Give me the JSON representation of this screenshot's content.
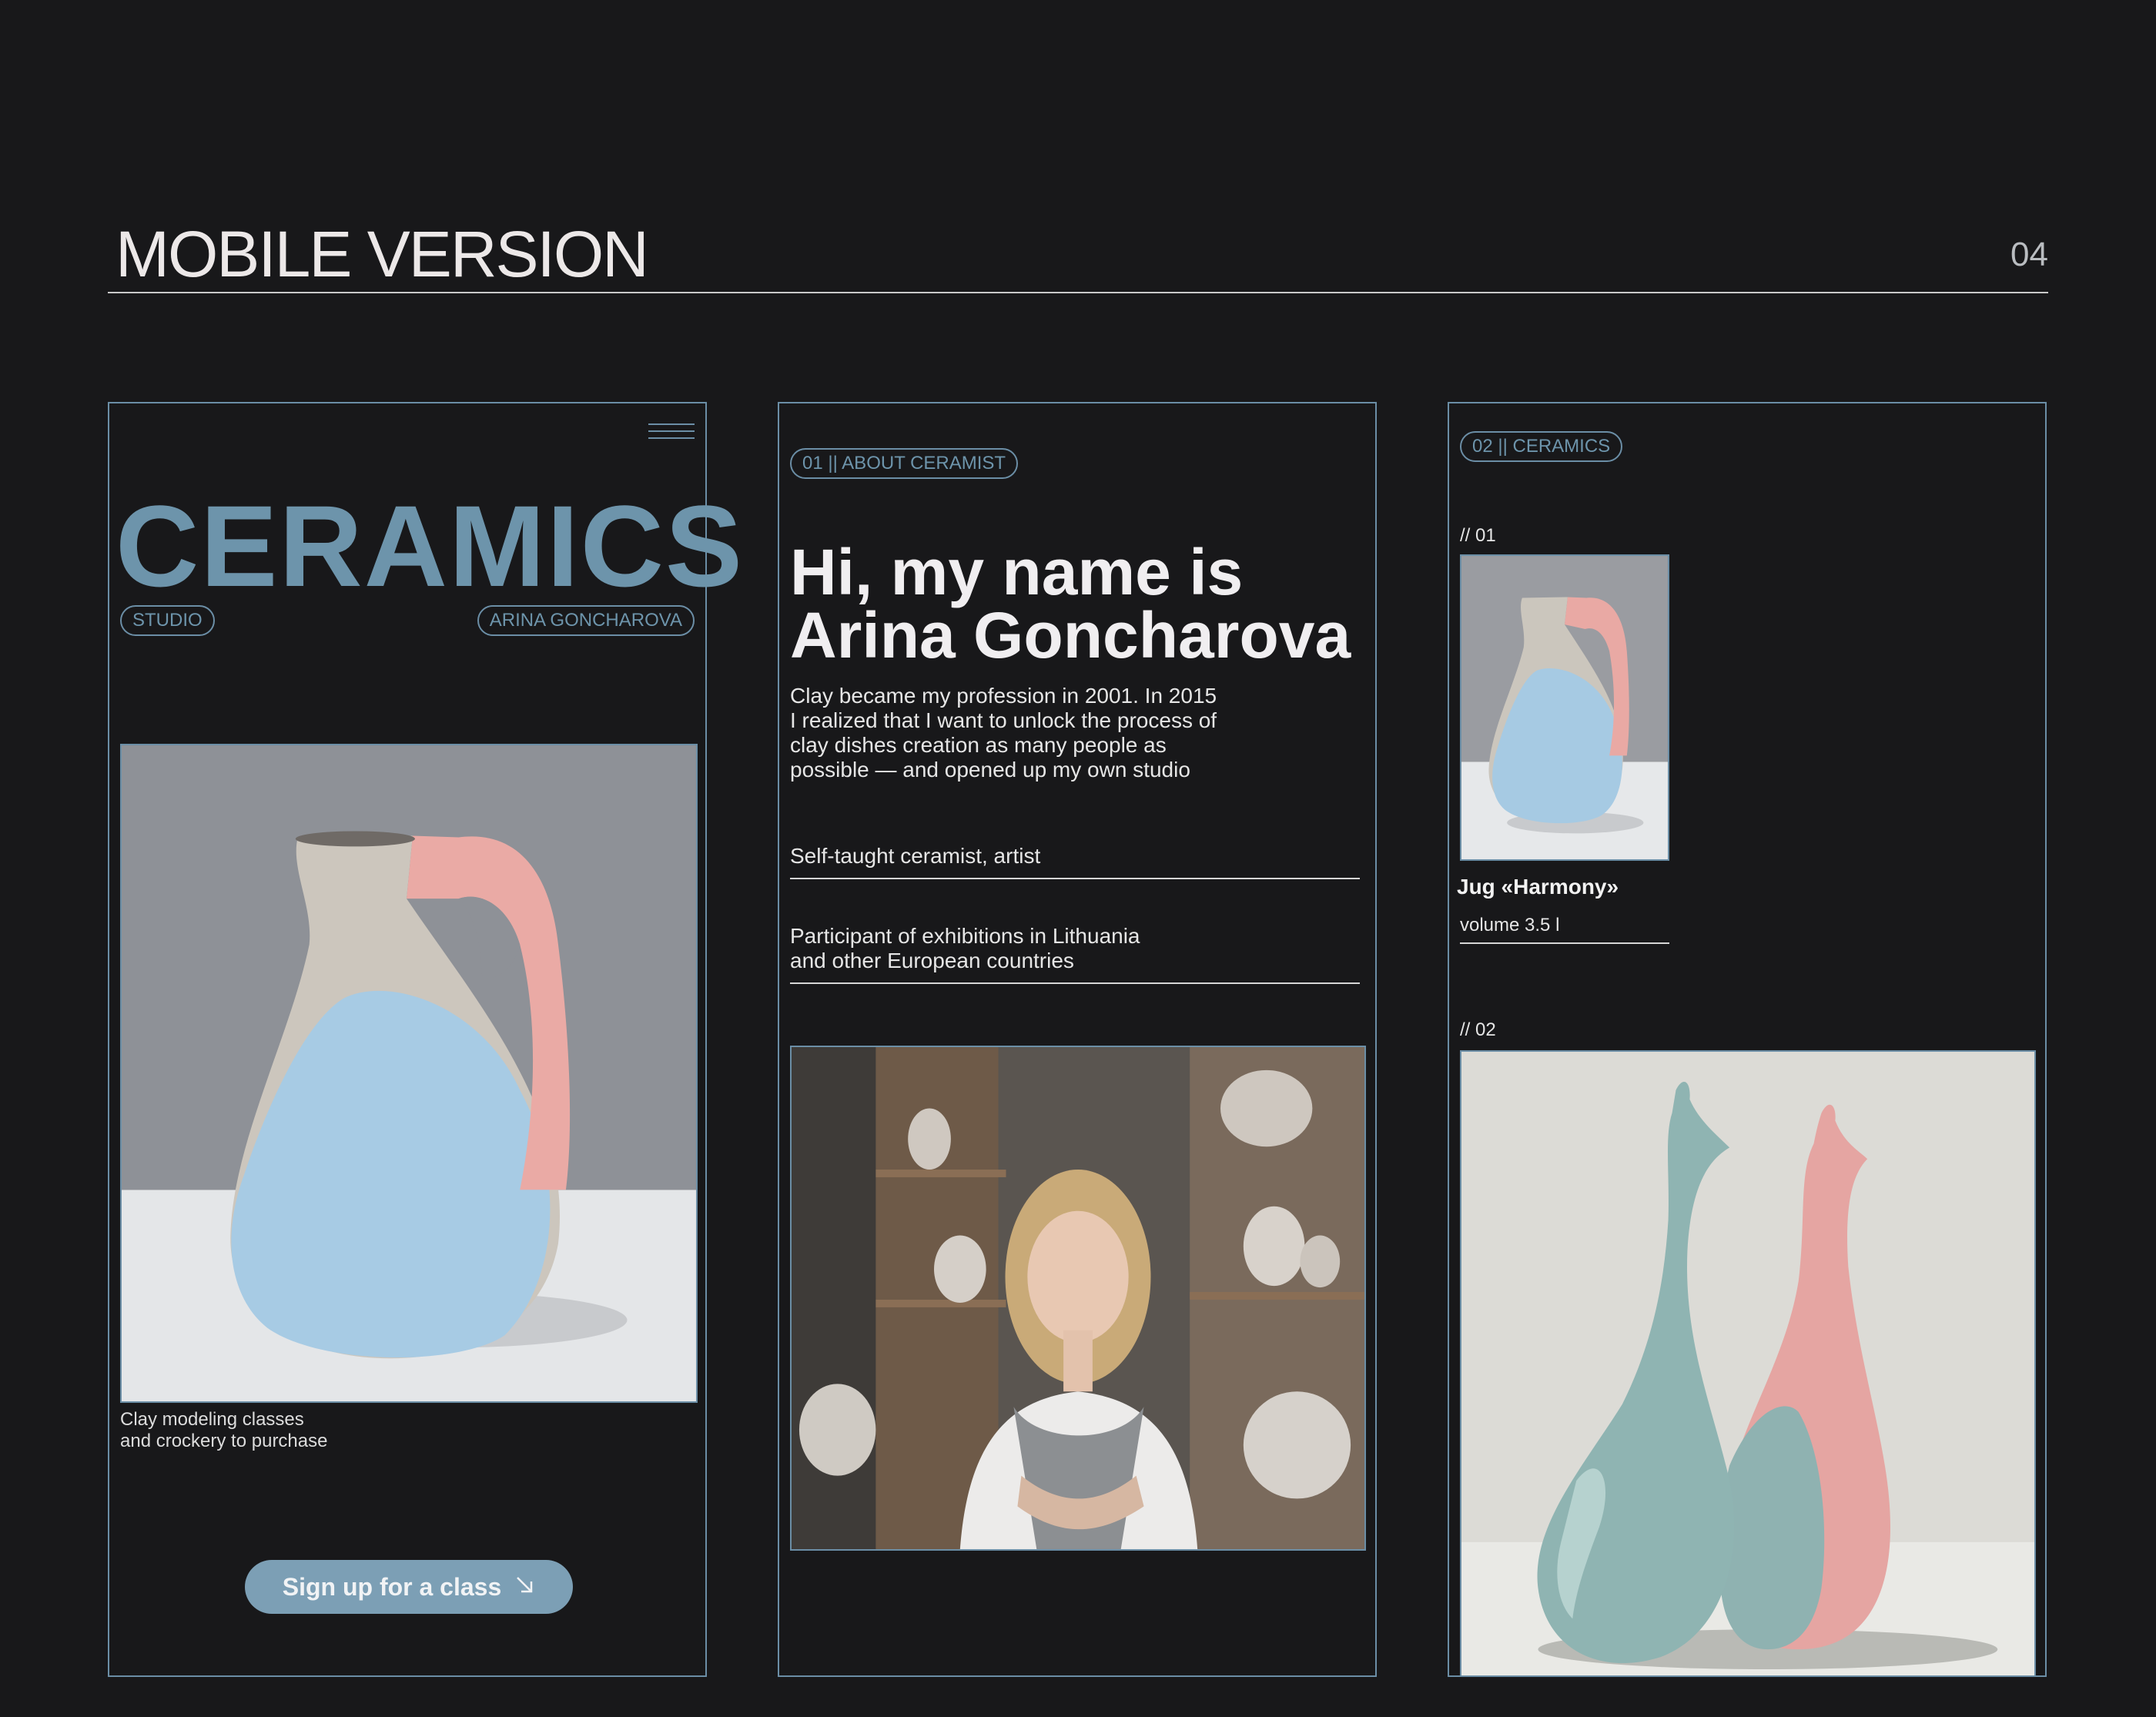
{
  "page": {
    "title": "MOBILE VERSION",
    "page_number": "04"
  },
  "colors": {
    "background": "#18181a",
    "accent": "#6d94ab",
    "button": "#7c9fb5",
    "text": "#e8e6e6"
  },
  "screen1": {
    "menu_icon": "hamburger-icon",
    "brand": "CERAMICS",
    "tag_left": "STUDIO",
    "tag_right": "ARINA GONCHAROVA",
    "image_alt": "pastel ceramic jug",
    "caption_line1": "Clay modeling classes",
    "caption_line2": "and crockery to purchase",
    "cta_label": "Sign up for a class",
    "cta_icon": "arrow-down-right-icon"
  },
  "screen2": {
    "section_tag": "01 || ABOUT CERAMIST",
    "heading_line1": "Hi, my name is",
    "heading_line2": "Arina Goncharova",
    "bio": "Clay became my profession in 2001. In 2015 I realized that I want to unlock the process of clay dishes creation as many people as possible — and opened up my own studio",
    "fact1": "Self-taught ceramist, artist",
    "fact2_line1": "Participant of exhibitions in Lithuania",
    "fact2_line2": "and other European countries",
    "image_alt": "ceramist portrait in studio"
  },
  "screen3": {
    "section_tag": "02 || CERAMICS",
    "item1_index": "// 01",
    "item1_name": "Jug «Harmony»",
    "item1_volume": "volume 3.5 l",
    "item2_index": "// 02"
  }
}
